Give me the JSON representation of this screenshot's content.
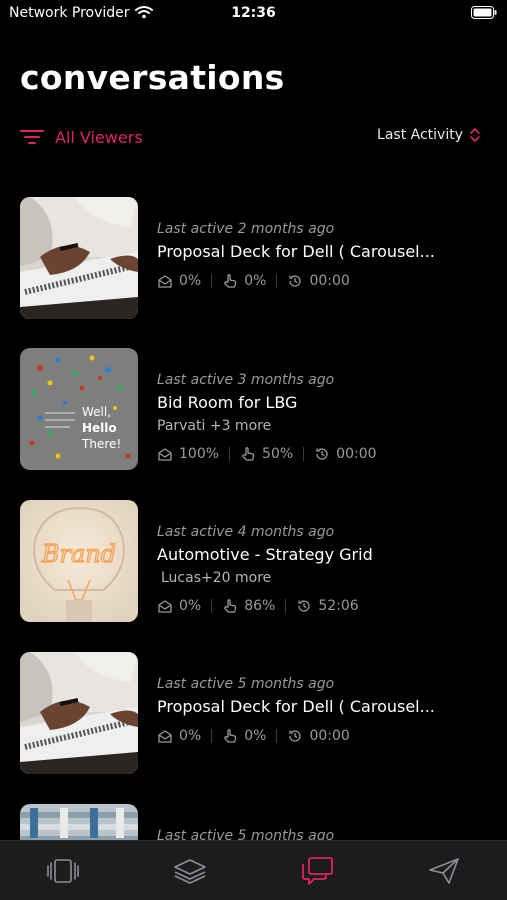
{
  "status": {
    "carrier": "Network Provider",
    "time": "12:36"
  },
  "title": "conversations",
  "filter": {
    "label": "All Viewers"
  },
  "sort": {
    "label": "Last Activity"
  },
  "colors": {
    "accent": "#e0245e",
    "background": "#000000",
    "tabbar": "#1c1c1e",
    "muted": "#9a9a9a"
  },
  "conversations": [
    {
      "last_active": "Last active 2 months ago",
      "title": "Proposal Deck for Dell ( Carousel...",
      "viewers": "",
      "opened": "0%",
      "engagement": "0%",
      "time": "00:00",
      "thumbnail": "woman-writing-notebook"
    },
    {
      "last_active": "Last active 3 months ago",
      "title": "Bid Room for LBG",
      "viewers": "Parvati +3 more",
      "opened": "100%",
      "engagement": "50%",
      "time": "00:00",
      "thumbnail": "well-hello-there",
      "thumb_text": [
        "Well,",
        "Hello",
        "There!"
      ]
    },
    {
      "last_active": "Last active 4 months ago",
      "title": "Automotive - Strategy Grid",
      "viewers": "Lucas+20 more",
      "opened": "0%",
      "engagement": "86%",
      "time": "52:06",
      "thumbnail": "brand-neon-bulb",
      "thumb_text": [
        "Brand"
      ]
    },
    {
      "last_active": "Last active 5 months ago",
      "title": "Proposal Deck for Dell ( Carousel...",
      "viewers": "",
      "opened": "0%",
      "engagement": "0%",
      "time": "00:00",
      "thumbnail": "woman-writing-notebook"
    },
    {
      "last_active": "Last active 5 months ago",
      "title": "",
      "viewers": "",
      "opened": "",
      "engagement": "",
      "time": "",
      "thumbnail": "circuit-board"
    }
  ],
  "tabs": [
    {
      "name": "cards-tab",
      "icon": "cards-icon",
      "active": false
    },
    {
      "name": "layers-tab",
      "icon": "layers-icon",
      "active": false
    },
    {
      "name": "conversations-tab",
      "icon": "chat-bubbles-icon",
      "active": true
    },
    {
      "name": "send-tab",
      "icon": "paper-plane-icon",
      "active": false
    }
  ]
}
